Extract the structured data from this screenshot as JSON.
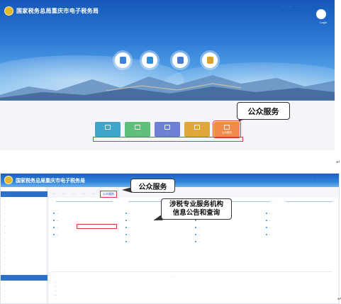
{
  "screenshot1": {
    "header": {
      "title": "国家税务总局重庆市电子税务局",
      "links": [
        "…",
        "…",
        "…",
        "…"
      ],
      "login_label": "Login"
    },
    "circle_nav": [
      {
        "label": "…",
        "color": "#3e82d8"
      },
      {
        "label": "…",
        "color": "#2f8fd2"
      },
      {
        "label": "…",
        "color": "#4b79cc"
      },
      {
        "label": "…",
        "color": "#d8a52a"
      }
    ],
    "tiles": [
      {
        "label": "…",
        "color": "#3ea6c9"
      },
      {
        "label": "…",
        "color": "#5fbf7a"
      },
      {
        "label": "…",
        "color": "#6d80d6"
      },
      {
        "label": "…",
        "color": "#e0a63a"
      },
      {
        "label": "公众服务",
        "color": "#f08b4a"
      }
    ],
    "notice": "…",
    "callout": "公众服务"
  },
  "screenshot2": {
    "header": {
      "title": "国家税务总局重庆市电子税务局",
      "links": [
        "…",
        "…",
        "…",
        "…"
      ]
    },
    "sidebar": {
      "sections": [
        {
          "title": "…",
          "items": [
            "…",
            "…",
            "…",
            "…",
            "…",
            "…",
            "…",
            "…",
            "…",
            "…",
            "…",
            "…"
          ]
        },
        {
          "title": "…",
          "items": [
            "…",
            "…",
            "…",
            "…",
            "…"
          ]
        },
        {
          "title": "…",
          "items": []
        }
      ]
    },
    "tabs": [
      "…",
      "…",
      "…",
      "…",
      "…",
      "公众服务"
    ],
    "content": {
      "sections": [
        "…",
        "…",
        "…"
      ],
      "col1_links": [
        "…",
        "…",
        "…",
        "…"
      ],
      "col2_links": [
        "…",
        "…",
        "…",
        "…",
        "…"
      ],
      "col3_links": [
        "…",
        "…",
        "…",
        "…",
        "…"
      ],
      "col4_links": [
        "…",
        "…",
        "…",
        "…"
      ],
      "notice_title": "…",
      "notice_right": "…",
      "notice_lines": [
        "…",
        "…",
        "…",
        "…"
      ]
    },
    "callout_tab": "公众服务",
    "callout_link": [
      "涉税专业服务机构",
      "信息公告和查询"
    ]
  }
}
